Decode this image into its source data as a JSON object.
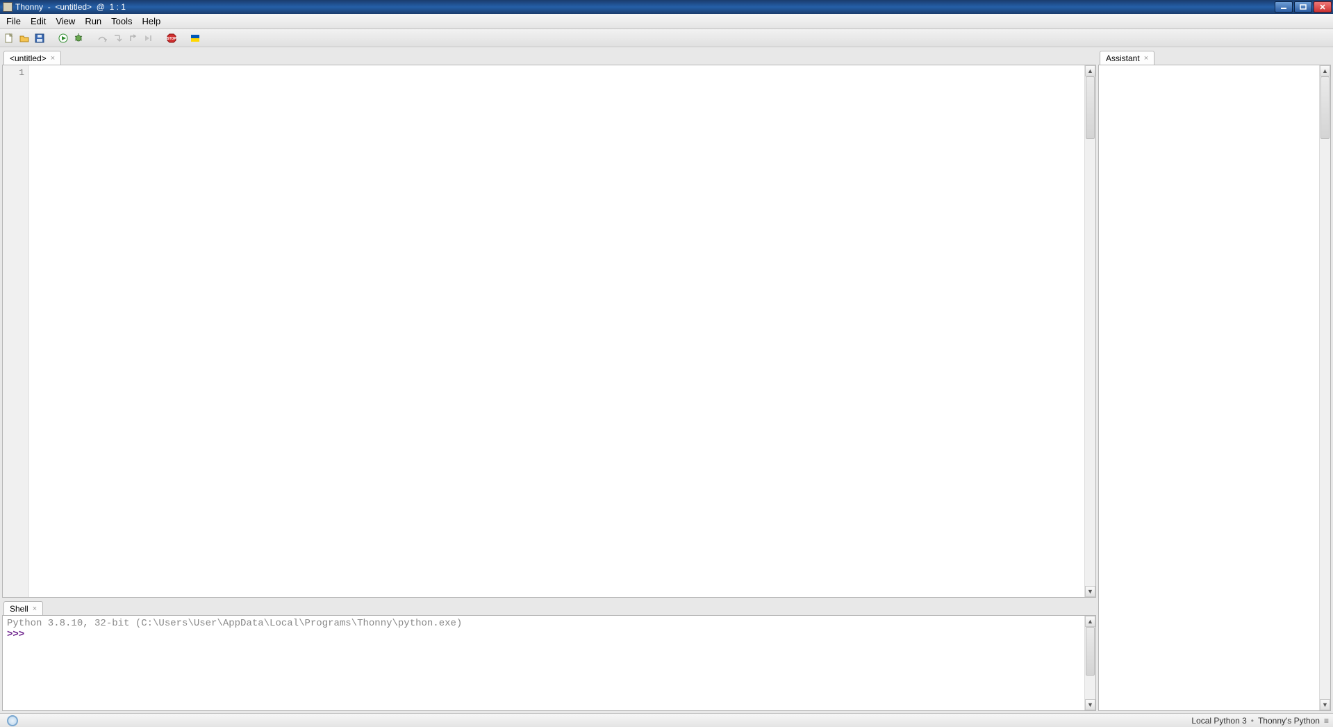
{
  "titlebar": {
    "text": "Thonny  -  <untitled>  @  1 : 1"
  },
  "menu": {
    "items": [
      "File",
      "Edit",
      "View",
      "Run",
      "Tools",
      "Help"
    ]
  },
  "toolbar": {
    "icons": [
      "new-file-icon",
      "open-file-icon",
      "save-file-icon",
      "run-icon",
      "debug-icon",
      "step-over-icon",
      "step-into-icon",
      "step-out-icon",
      "resume-icon",
      "stop-icon",
      "support-ukraine-icon"
    ]
  },
  "editor": {
    "tab_label": "<untitled>",
    "line_numbers": [
      "1"
    ],
    "content": ""
  },
  "shell": {
    "tab_label": "Shell",
    "info_line": "Python 3.8.10, 32-bit (C:\\Users\\User\\AppData\\Local\\Programs\\Thonny\\python.exe)",
    "prompt": ">>> "
  },
  "assistant": {
    "tab_label": "Assistant"
  },
  "statusbar": {
    "interpreter": "Local Python 3",
    "separator": "•",
    "backend": "Thonny's Python"
  }
}
